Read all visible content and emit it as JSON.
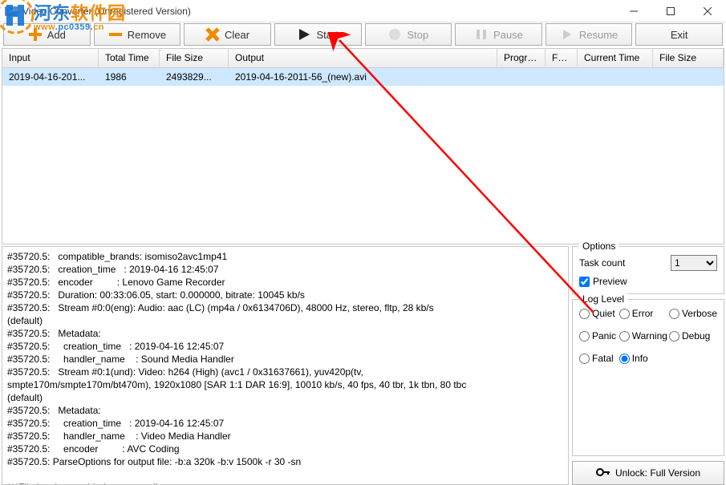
{
  "window": {
    "title": "Video Converter   (Unregistered Version)"
  },
  "watermark": {
    "brand_cn": "河东软件园",
    "url": "www.pc0359.cn"
  },
  "toolbar": {
    "add": "Add",
    "remove": "Remove",
    "clear": "Clear",
    "start": "Start",
    "stop": "Stop",
    "pause": "Pause",
    "resume": "Resume",
    "exit": "Exit"
  },
  "columns": {
    "input": "Input",
    "total_time": "Total Time",
    "file_size1": "File Size",
    "output": "Output",
    "progress": "Progress",
    "fps": "FPS",
    "current_time": "Current Time",
    "file_size2": "File Size"
  },
  "rows": [
    {
      "input": "2019-04-16-201...",
      "total_time": "1986",
      "file_size1": "2493829...",
      "output": "2019-04-16-2011-56_(new).avi",
      "progress": "",
      "fps": "",
      "current_time": "",
      "file_size2": ""
    }
  ],
  "log": "#35720.5:   compatible_brands: isomiso2avc1mp41\n#35720.5:   creation_time   : 2019-04-16 12:45:07\n#35720.5:   encoder         : Lenovo Game Recorder\n#35720.5:   Duration: 00:33:06.05, start: 0.000000, bitrate: 10045 kb/s\n#35720.5:   Stream #0:0(eng): Audio: aac (LC) (mp4a / 0x6134706D), 48000 Hz, stereo, fltp, 28 kb/s\n(default)\n#35720.5:   Metadata:\n#35720.5:     creation_time   : 2019-04-16 12:45:07\n#35720.5:     handler_name    : Sound Media Handler\n#35720.5:   Stream #0:1(und): Video: h264 (High) (avc1 / 0x31637661), yuv420p(tv,\nsmpte170m/smpte170m/bt470m), 1920x1080 [SAR 1:1 DAR 16:9], 10010 kb/s, 40 fps, 40 tbr, 1k tbn, 80 tbc\n(default)\n#35720.5:   Metadata:\n#35720.5:     creation_time   : 2019-04-16 12:45:07\n#35720.5:     handler_name    : Video Media Handler\n#35720.5:     encoder         : AVC Coding\n#35720.5: ParseOptions for output file: -b:a 320k -b:v 1500k -r 30 -sn\n\n***File has been added to convert list",
  "options": {
    "legend": "Options",
    "task_count_label": "Task count",
    "task_count_value": "1",
    "preview_label": "Preview"
  },
  "loglevel": {
    "legend": "Log Level",
    "quiet": "Quiet",
    "error": "Error",
    "verbose": "Verbose",
    "panic": "Panic",
    "warning": "Warning",
    "debug": "Debug",
    "fatal": "Fatal",
    "info": "Info",
    "selected": "info"
  },
  "unlock": "Unlock: Full Version"
}
